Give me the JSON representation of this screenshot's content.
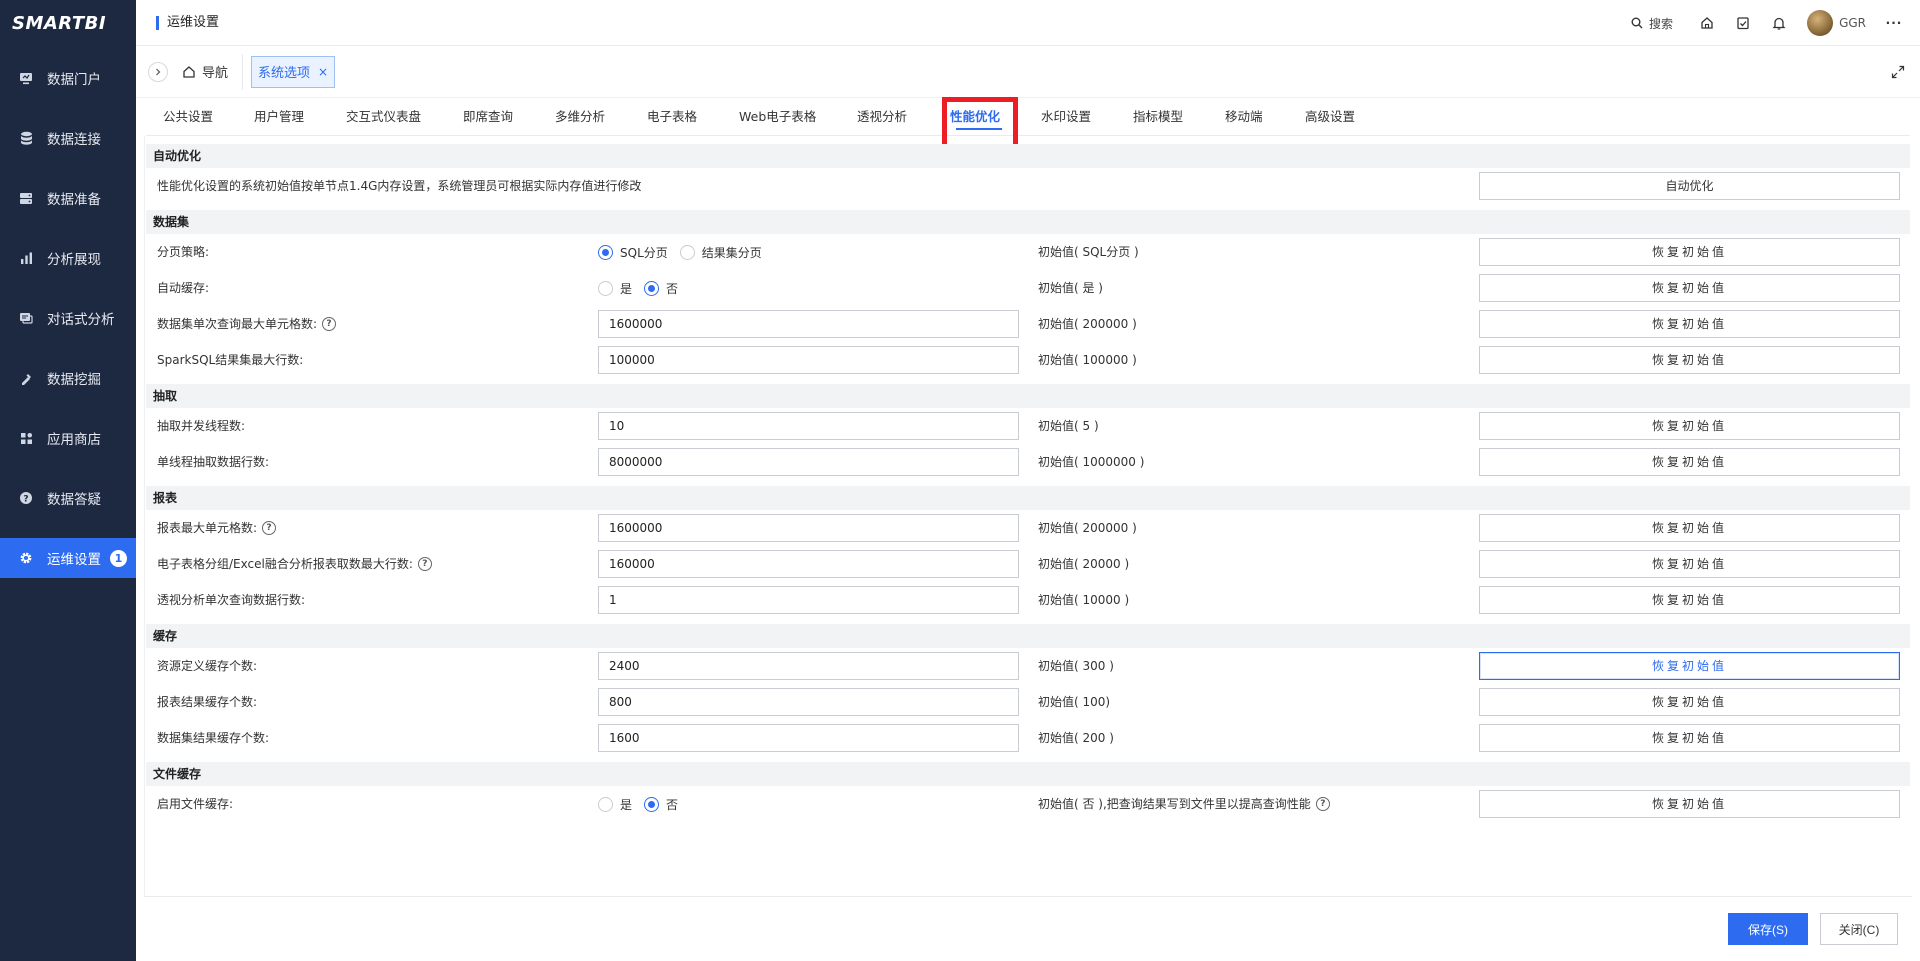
{
  "sidebar": {
    "logo": "SMARTBI",
    "items": [
      {
        "label": "数据门户",
        "icon": "monitor-icon"
      },
      {
        "label": "数据连接",
        "icon": "database-icon"
      },
      {
        "label": "数据准备",
        "icon": "server-icon"
      },
      {
        "label": "分析展现",
        "icon": "bar-chart-icon"
      },
      {
        "label": "对话式分析",
        "icon": "chat-icon"
      },
      {
        "label": "数据挖掘",
        "icon": "pickaxe-icon"
      },
      {
        "label": "应用商店",
        "icon": "apps-icon"
      },
      {
        "label": "数据答疑",
        "icon": "question-icon"
      },
      {
        "label": "运维设置",
        "icon": "gear-icon",
        "active": true,
        "badge": "1"
      }
    ]
  },
  "topbar": {
    "title": "运维设置",
    "search_label": "搜索",
    "username": "GGR",
    "more": "···"
  },
  "navrow": {
    "home_label": "导航",
    "open_tab_label": "系统选项",
    "close": "×"
  },
  "tabs": [
    {
      "label": "公共设置"
    },
    {
      "label": "用户管理"
    },
    {
      "label": "交互式仪表盘"
    },
    {
      "label": "即席查询"
    },
    {
      "label": "多维分析"
    },
    {
      "label": "电子表格"
    },
    {
      "label": "Web电子表格"
    },
    {
      "label": "透视分析"
    },
    {
      "label": "性能优化",
      "active": true
    },
    {
      "label": "水印设置"
    },
    {
      "label": "指标模型"
    },
    {
      "label": "移动端"
    },
    {
      "label": "高级设置"
    }
  ],
  "sections": {
    "auto": {
      "title": "自动优化",
      "warning": "性能优化设置的系统初始值按单节点1.4G内存设置，系统管理员可根据实际内存值进行修改",
      "button": "自动优化"
    },
    "dataset": {
      "title": "数据集",
      "rows": [
        {
          "label": "分页策略:",
          "options": [
            "SQL分页",
            "结果集分页"
          ],
          "selected": "SQL分页",
          "init": "初始值( SQL分页 )",
          "button": "恢复初始值"
        },
        {
          "label": "自动缓存:",
          "options": [
            "是",
            "否"
          ],
          "selected": "否",
          "init": "初始值( 是 )",
          "button": "恢复初始值"
        },
        {
          "label": "数据集单次查询最大单元格数:",
          "help": "?",
          "value": "1600000",
          "init": "初始值( 200000 )",
          "button": "恢复初始值"
        },
        {
          "label": "SparkSQL结果集最大行数:",
          "value": "100000",
          "init": "初始值( 100000 )",
          "button": "恢复初始值"
        }
      ]
    },
    "extract": {
      "title": "抽取",
      "rows": [
        {
          "label": "抽取并发线程数:",
          "value": "10",
          "init": "初始值( 5 )",
          "button": "恢复初始值"
        },
        {
          "label": "单线程抽取数据行数:",
          "value": "8000000",
          "init": "初始值( 1000000 )",
          "button": "恢复初始值"
        }
      ]
    },
    "report": {
      "title": "报表",
      "rows": [
        {
          "label": "报表最大单元格数:",
          "help": "?",
          "value": "1600000",
          "init": "初始值( 200000 )",
          "button": "恢复初始值"
        },
        {
          "label": "电子表格分组/Excel融合分析报表取数最大行数:",
          "help": "?",
          "value": "160000",
          "init": "初始值( 20000 )",
          "button": "恢复初始值"
        },
        {
          "label": "透视分析单次查询数据行数:",
          "value": "1",
          "init": "初始值( 10000 )",
          "button": "恢复初始值"
        }
      ]
    },
    "cache": {
      "title": "缓存",
      "rows": [
        {
          "label": "资源定义缓存个数:",
          "value": "2400",
          "init": "初始值( 300 )",
          "button": "恢复初始值"
        },
        {
          "label": "报表结果缓存个数:",
          "value": "800",
          "init": "初始值( 100)",
          "button": "恢复初始值"
        },
        {
          "label": "数据集结果缓存个数:",
          "value": "1600",
          "init": "初始值( 200 )",
          "button": "恢复初始值"
        }
      ]
    },
    "filecache": {
      "title": "文件缓存",
      "rows": [
        {
          "label": "启用文件缓存:",
          "options": [
            "是",
            "否"
          ],
          "selected": "否",
          "init": "初始值( 否 ),把查询结果写到文件里以提高查询性能",
          "help": "?",
          "button": "恢复初始值"
        }
      ]
    }
  },
  "footer": {
    "save": "保存(S)",
    "close": "关闭(C)"
  },
  "colors": {
    "sidebar_bg": "#1d2940",
    "accent": "#2d6cf0",
    "warning": "#e11d1d",
    "highlight": "#ee1c24"
  }
}
